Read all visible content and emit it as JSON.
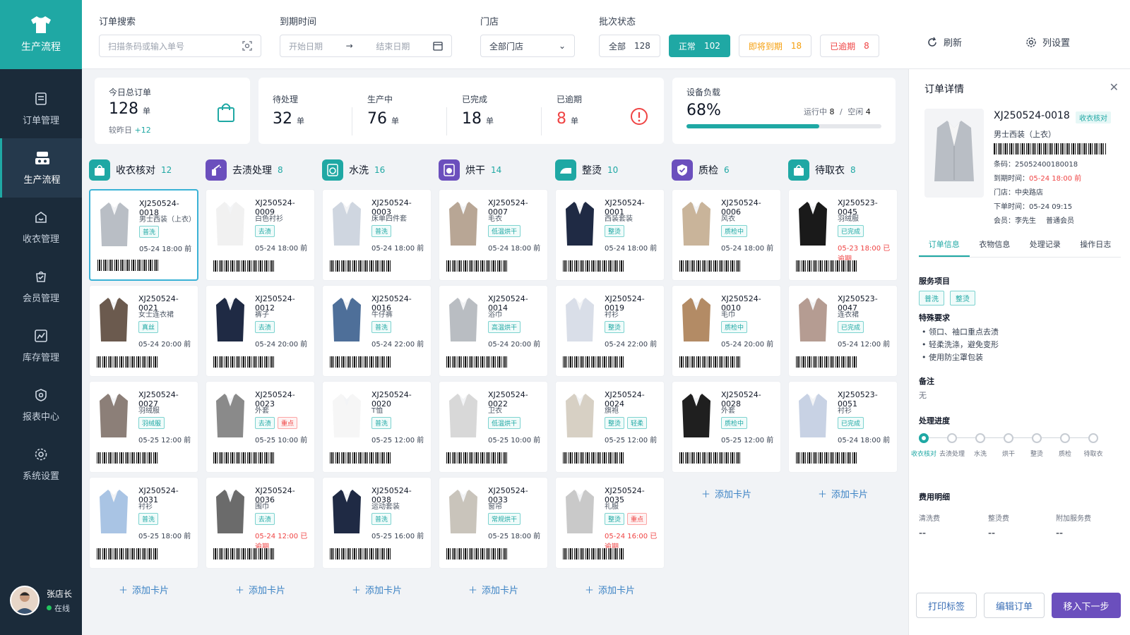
{
  "sidebar": {
    "brand": "生产流程",
    "items": [
      {
        "label": "订单管理",
        "icon": "order-icon"
      },
      {
        "label": "生产流程",
        "icon": "flow-icon",
        "active": true
      },
      {
        "label": "收衣管理",
        "icon": "receive-icon"
      },
      {
        "label": "会员管理",
        "icon": "member-icon"
      },
      {
        "label": "库存管理",
        "icon": "inventory-icon"
      },
      {
        "label": "报表中心",
        "icon": "report-icon"
      },
      {
        "label": "系统设置",
        "icon": "settings-icon"
      }
    ],
    "user": {
      "name": "张店长",
      "status": "在线"
    }
  },
  "filters": {
    "search_label": "订单搜索",
    "search_placeholder": "扫描条码或输入单号",
    "date_label": "到期时间",
    "date_start": "开始日期",
    "date_arrow": "→",
    "date_end": "结束日期",
    "store_label": "门店",
    "store_value": "全部门店",
    "batch_label": "批次状态",
    "chips": [
      {
        "label": "全部",
        "count": "128"
      },
      {
        "label": "正常",
        "count": "102"
      },
      {
        "label": "即将到期",
        "count": "18"
      },
      {
        "label": "已逾期",
        "count": "8"
      }
    ],
    "refresh": "刷新",
    "columns": "列设置"
  },
  "stats": {
    "today_label": "今日总订单",
    "today_value": "128",
    "unit": "单",
    "yesterday_label": "较昨日",
    "yesterday_delta": "+12",
    "pending_label": "待处理",
    "pending_value": "32",
    "inprod_label": "生产中",
    "inprod_value": "76",
    "done_label": "已完成",
    "done_value": "18",
    "overdue_label": "已逾期",
    "overdue_value": "8",
    "load_label": "设备负载",
    "load_value": "68%",
    "load_fraction": 0.68,
    "running_label": "运行中",
    "running_value": "8",
    "sep": "/",
    "idle_label": "空闲",
    "idle_value": "4"
  },
  "columns": [
    {
      "title": "收衣核对",
      "count": "12",
      "color": "#1fa8a4",
      "icon": "bag-icon"
    },
    {
      "title": "去渍处理",
      "count": "8",
      "color": "#6b4fbd",
      "icon": "spray-icon"
    },
    {
      "title": "水洗",
      "count": "16",
      "color": "#1fa8a4",
      "icon": "washer-icon"
    },
    {
      "title": "烘干",
      "count": "14",
      "color": "#6b4fbd",
      "icon": "dryer-icon"
    },
    {
      "title": "整烫",
      "count": "10",
      "color": "#1fa8a4",
      "icon": "iron-icon"
    },
    {
      "title": "质检",
      "count": "6",
      "color": "#6b4fbd",
      "icon": "shield-icon"
    },
    {
      "title": "待取衣",
      "count": "8",
      "color": "#1fa8a4",
      "icon": "bag-icon"
    }
  ],
  "add_card": "添加卡片",
  "cards": [
    [
      {
        "no": "XJ250524-0018",
        "type": "男士西装（上衣）",
        "tags": [
          "普洗"
        ],
        "due": "05-24 18:00 前"
      },
      {
        "no": "XJ250524-0021",
        "type": "女士连衣裙",
        "tags": [
          "真丝"
        ],
        "due": "05-24 20:00 前"
      },
      {
        "no": "XJ250524-0027",
        "type": "羽绒服",
        "tags": [
          "羽绒服"
        ],
        "due": "05-25 12:00 前"
      },
      {
        "no": "XJ250524-0031",
        "type": "衬衫",
        "tags": [
          "普洗"
        ],
        "due": "05-25 18:00 前"
      }
    ],
    [
      {
        "no": "XJ250524-0009",
        "type": "白色衬衫",
        "tags": [
          "去渍"
        ],
        "due": "05-24 18:00 前"
      },
      {
        "no": "XJ250524-0012",
        "type": "裤子",
        "tags": [
          "去渍"
        ],
        "due": "05-24 20:00 前"
      },
      {
        "no": "XJ250524-0023",
        "type": "外套",
        "tags": [
          "去渍",
          "重点"
        ],
        "due": "05-25 10:00 前"
      },
      {
        "no": "XJ250524-0036",
        "type": "围巾",
        "tags": [
          "去渍"
        ],
        "due": "05-24 12:00 已逾期",
        "over": true
      }
    ],
    [
      {
        "no": "XJ250524-0003",
        "type": "床单四件套",
        "tags": [
          "普洗"
        ],
        "due": "05-24 18:00 前"
      },
      {
        "no": "XJ250524-0016",
        "type": "牛仔裤",
        "tags": [
          "普洗"
        ],
        "due": "05-24 22:00 前"
      },
      {
        "no": "XJ250524-0020",
        "type": "T恤",
        "tags": [
          "普洗"
        ],
        "due": "05-25 12:00 前"
      },
      {
        "no": "XJ250524-0038",
        "type": "运动套装",
        "tags": [
          "普洗"
        ],
        "due": "05-25 16:00 前"
      }
    ],
    [
      {
        "no": "XJ250524-0007",
        "type": "毛衣",
        "tags": [
          "低温烘干"
        ],
        "due": "05-24 18:00 前"
      },
      {
        "no": "XJ250524-0014",
        "type": "浴巾",
        "tags": [
          "高温烘干"
        ],
        "due": "05-24 20:00 前"
      },
      {
        "no": "XJ250524-0022",
        "type": "卫衣",
        "tags": [
          "低温烘干"
        ],
        "due": "05-25 10:00 前"
      },
      {
        "no": "XJ250524-0033",
        "type": "窗帘",
        "tags": [
          "常规烘干"
        ],
        "due": "05-25 18:00 前"
      }
    ],
    [
      {
        "no": "XJ250524-0001",
        "type": "西装套装",
        "tags": [
          "整烫"
        ],
        "due": "05-24 18:00 前"
      },
      {
        "no": "XJ250524-0019",
        "type": "衬衫",
        "tags": [
          "整烫"
        ],
        "due": "05-24 22:00 前"
      },
      {
        "no": "XJ250524-0024",
        "type": "旗袍",
        "tags": [
          "整烫",
          "轻柔"
        ],
        "due": "05-25 12:00 前"
      },
      {
        "no": "XJ250524-0035",
        "type": "礼服",
        "tags": [
          "整烫",
          "重点"
        ],
        "due": "05-24 16:00 已逾期",
        "over": true
      }
    ],
    [
      {
        "no": "XJ250524-0006",
        "type": "风衣",
        "tags": [
          "质检中"
        ],
        "due": "05-24 18:00 前"
      },
      {
        "no": "XJ250524-0010",
        "type": "毛巾",
        "tags": [
          "质检中"
        ],
        "due": "05-24 20:00 前"
      },
      {
        "no": "XJ250524-0028",
        "type": "外套",
        "tags": [
          "质检中"
        ],
        "due": "05-25 12:00 前"
      }
    ],
    [
      {
        "no": "XJ250523-0045",
        "type": "羽绒服",
        "tags": [
          "已完成"
        ],
        "due": "05-23 18:00 已逾期",
        "over": true
      },
      {
        "no": "XJ250523-0047",
        "type": "连衣裙",
        "tags": [
          "已完成"
        ],
        "due": "05-24 12:00 前"
      },
      {
        "no": "XJ250523-0051",
        "type": "衬衫",
        "tags": [
          "已完成"
        ],
        "due": "05-24 18:00 前"
      }
    ]
  ],
  "detail": {
    "title": "订单详情",
    "no": "XJ250524-0018",
    "badge": "收衣核对",
    "type": "男士西装（上衣）",
    "barcode": "条码：25052400180018",
    "due_label": "到期时间：",
    "due_value": "05-24 18:00 前",
    "store": "门店：中央路店",
    "ordered": "下单时间：05-24 09:15",
    "member_label": "会员：李先生",
    "member_level": "普通会员",
    "tabs": [
      "订单信息",
      "衣物信息",
      "处理记录",
      "操作日志"
    ],
    "service_label": "服务项目",
    "services": [
      "普洗",
      "整烫"
    ],
    "special_label": "特殊要求",
    "special": [
      "• 领口、袖口重点去渍",
      "• 轻柔洗涤，避免变形",
      "• 使用防尘罩包装"
    ],
    "remark_label": "备注",
    "remark": "无",
    "progress_label": "处理进度",
    "steps": [
      "收衣核对",
      "去渍处理",
      "水洗",
      "烘干",
      "整烫",
      "质检",
      "待取衣"
    ],
    "fee_label": "费用明细",
    "fees": [
      {
        "name": "清洗费",
        "value": "--"
      },
      {
        "name": "整烫费",
        "value": "--"
      },
      {
        "name": "附加服务费",
        "value": "--"
      }
    ],
    "btn_print": "打印标签",
    "btn_edit": "编辑订单",
    "btn_next": "移入下一步"
  },
  "colors": {
    "accent": "#1fa8a4",
    "purple": "#6b4fbd",
    "danger": "#ef4444",
    "warning": "#f59e0b",
    "sidebar": "#1b2b3a"
  }
}
